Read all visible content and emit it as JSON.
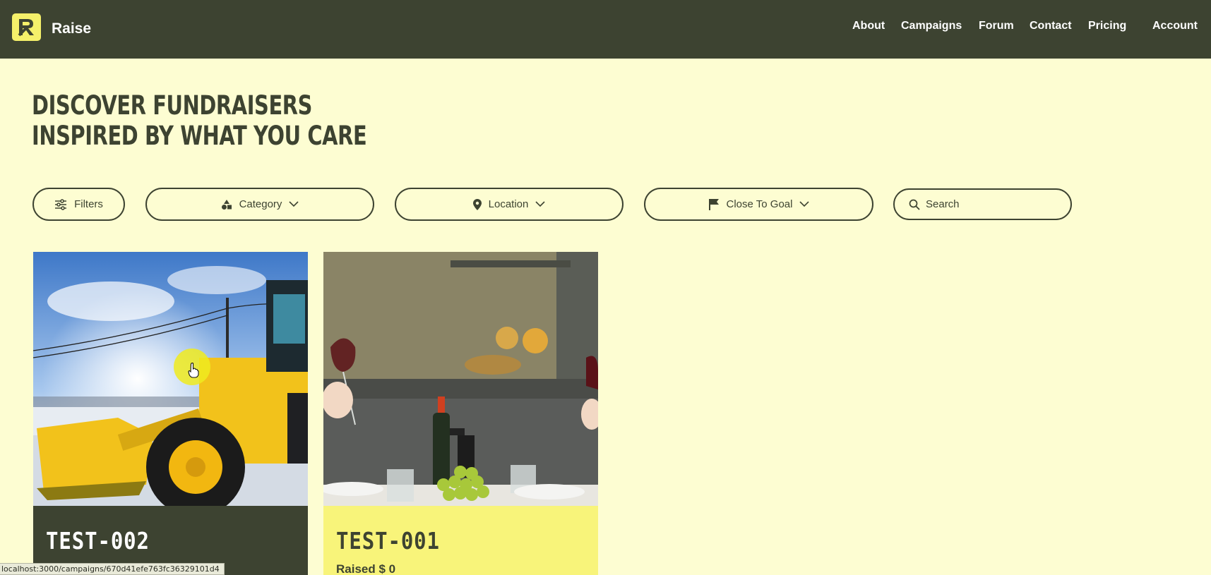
{
  "brand": {
    "name": "Raise",
    "logo_icon": "raise-logo-icon"
  },
  "nav": {
    "items": [
      {
        "label": "About"
      },
      {
        "label": "Campaigns"
      },
      {
        "label": "Forum"
      },
      {
        "label": "Contact"
      },
      {
        "label": "Pricing"
      },
      {
        "label": "Account"
      }
    ]
  },
  "hero": {
    "line1": "DISCOVER FUNDRAISERS",
    "line2": "INSPIRED BY WHAT YOU CARE"
  },
  "filters": {
    "filters_label": "Filters",
    "category_label": "Category",
    "location_label": "Location",
    "sort_label": "Close To Goal",
    "search_placeholder": "Search"
  },
  "campaigns": [
    {
      "title": "TEST-002",
      "raised": "",
      "image": "snow-plow-loader-photo"
    },
    {
      "title": "TEST-001",
      "raised": "Raised $ 0",
      "image": "wine-dinner-table-photo"
    }
  ],
  "status_bar": {
    "url": "localhost:3000/campaigns/670d41efe763fc36329101d4"
  },
  "colors": {
    "header_bg": "#3d4331",
    "page_bg": "#fdfdd2",
    "accent_yellow": "#f5f06a",
    "card_dark": "#3d4331",
    "card_light": "#f8f47a"
  }
}
